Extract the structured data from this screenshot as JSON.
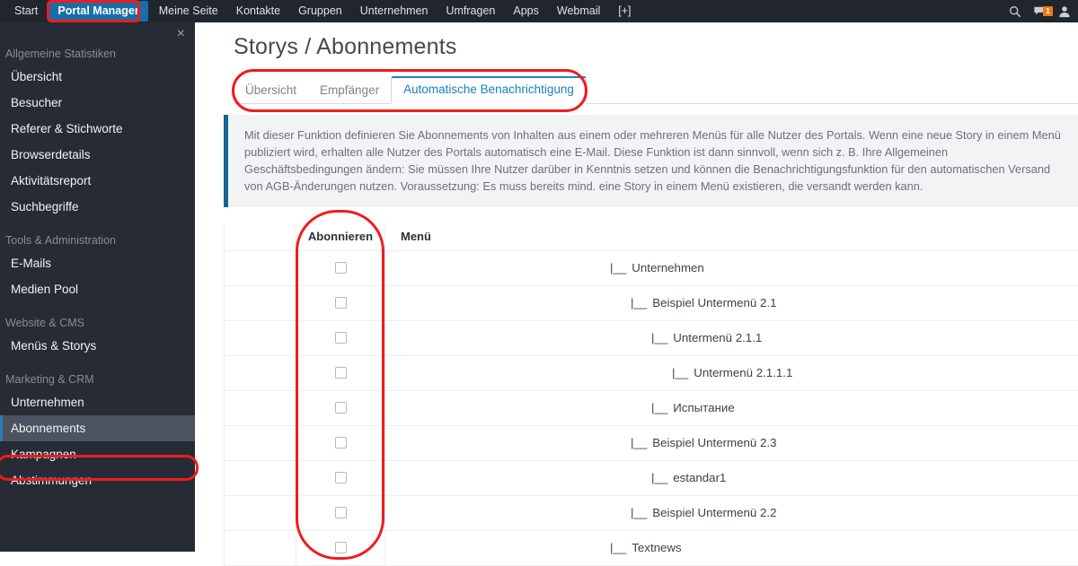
{
  "topnav": {
    "items": [
      {
        "label": "Start",
        "active": false
      },
      {
        "label": "Portal Manager",
        "active": true
      },
      {
        "label": "Meine Seite",
        "active": false
      },
      {
        "label": "Kontakte",
        "active": false
      },
      {
        "label": "Gruppen",
        "active": false
      },
      {
        "label": "Unternehmen",
        "active": false
      },
      {
        "label": "Umfragen",
        "active": false
      },
      {
        "label": "Apps",
        "active": false
      },
      {
        "label": "Webmail",
        "active": false
      },
      {
        "label": "[+]",
        "active": false
      }
    ],
    "icons": [
      "search-icon",
      "messages-icon",
      "user-icon"
    ],
    "message_badge": "1",
    "badge_color": "#f07818",
    "active_color": "#1a6ea8"
  },
  "sidebar": {
    "close_label": "×",
    "groups": [
      {
        "title": "Allgemeine Statistiken",
        "items": [
          {
            "label": "Übersicht",
            "active": false
          },
          {
            "label": "Besucher",
            "active": false
          },
          {
            "label": "Referer & Stichworte",
            "active": false
          },
          {
            "label": "Browserdetails",
            "active": false
          },
          {
            "label": "Aktivitätsreport",
            "active": false
          },
          {
            "label": "Suchbegriffe",
            "active": false
          }
        ]
      },
      {
        "title": "Tools & Administration",
        "items": [
          {
            "label": "E-Mails",
            "active": false
          },
          {
            "label": "Medien Pool",
            "active": false
          }
        ]
      },
      {
        "title": "Website & CMS",
        "items": [
          {
            "label": "Menüs & Storys",
            "active": false
          }
        ]
      },
      {
        "title": "Marketing & CRM",
        "items": [
          {
            "label": "Unternehmen",
            "active": false
          },
          {
            "label": "Abonnements",
            "active": true
          },
          {
            "label": "Kampagnen",
            "active": false
          },
          {
            "label": "Abstimmungen",
            "active": false
          }
        ]
      }
    ],
    "accent_color": "#2a7fb8",
    "background": "#262b35"
  },
  "main": {
    "title": "Storys / Abonnements",
    "tabs": [
      {
        "label": "Übersicht",
        "active": false
      },
      {
        "label": "Empfänger",
        "active": false
      },
      {
        "label": "Automatische Benachrichtigung",
        "active": true
      }
    ],
    "tab_active_color": "#1a7fc1",
    "info_text": "Mit dieser Funktion definieren Sie Abonnements von Inhalten aus einem oder mehreren Menüs für alle Nutzer des Portals. Wenn eine neue Story in einem Menü publiziert wird, erhalten alle Nutzer des Portals automatisch eine E-Mail. Diese Funktion ist dann sinnvoll, wenn sich z. B. Ihre Allgemeinen Geschäftsbedingungen ändern: Sie müssen Ihre Nutzer darüber in Kenntnis setzen und können die Benachrichtigungsfunktion für den automatischen Versand von AGB-Änderungen nutzen. Voraussetzung: Es muss bereits mind. eine Story in einem Menü existieren, die versandt werden kann.",
    "info_border_color": "#15658f",
    "table": {
      "headers": {
        "spacer": "",
        "subscribe": "Abonnieren",
        "menu": "Menü"
      },
      "rows": [
        {
          "prefix": "|__",
          "label": "Unternehmen",
          "level": 0,
          "checked": false
        },
        {
          "prefix": "|__",
          "label": "Beispiel Untermenü 2.1",
          "level": 1,
          "checked": false
        },
        {
          "prefix": "|__",
          "label": "Untermenü 2.1.1",
          "level": 2,
          "checked": false
        },
        {
          "prefix": "|__",
          "label": "Untermenü 2.1.1.1",
          "level": 3,
          "checked": false
        },
        {
          "prefix": "|__",
          "label": "Испытание",
          "level": 2,
          "checked": false
        },
        {
          "prefix": "|__",
          "label": "Beispiel Untermenü 2.3",
          "level": 1,
          "checked": false
        },
        {
          "prefix": "|__",
          "label": "estandar1",
          "level": 2,
          "checked": false
        },
        {
          "prefix": "|__",
          "label": "Beispiel Untermenü 2.2",
          "level": 1,
          "checked": false
        },
        {
          "prefix": "|__",
          "label": "Textnews",
          "level": 0,
          "checked": false
        }
      ]
    }
  },
  "annotations": {
    "color": "#ee1c1c",
    "targets": [
      "portal-manager-nav",
      "abonnements-sidebar-item",
      "tab-strip",
      "abonnieren-column"
    ]
  }
}
